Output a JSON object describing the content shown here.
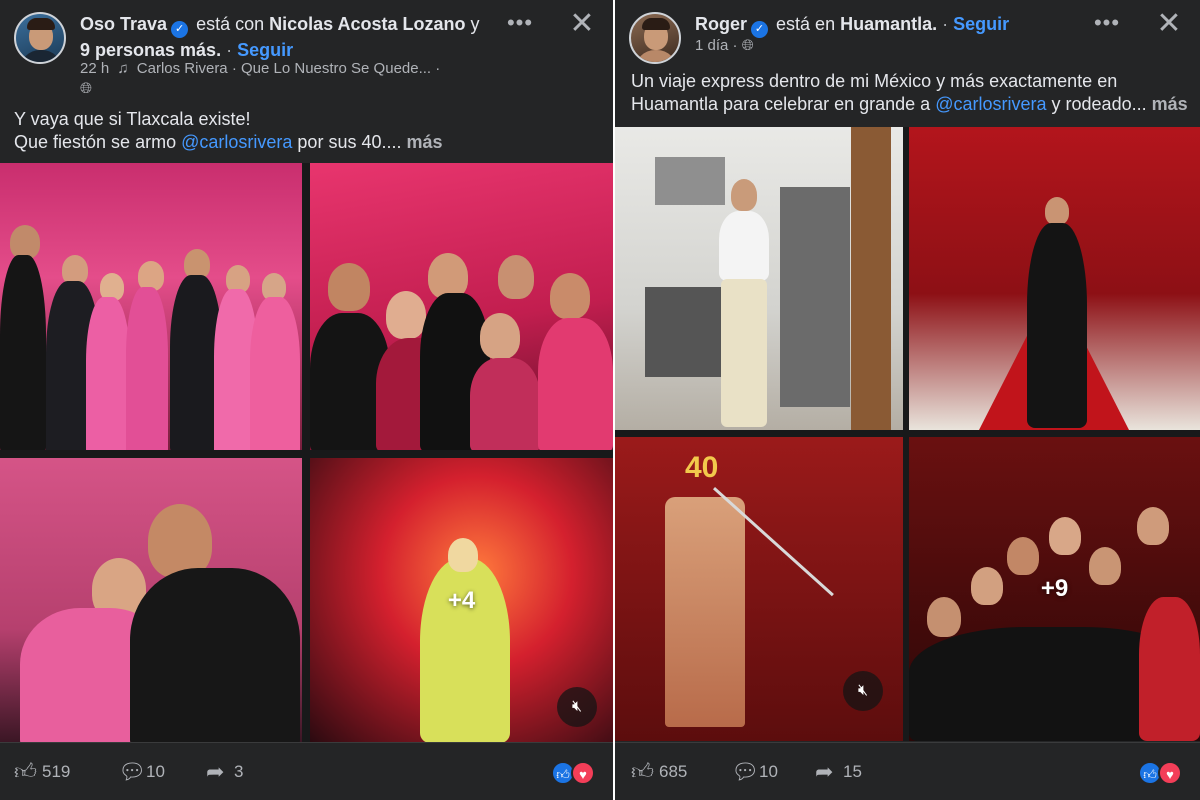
{
  "left_post": {
    "author": "Oso Trava",
    "with_text": "está con",
    "tagged": "Nicolas Acosta Lozano",
    "and_text": "y",
    "others": "9 personas más.",
    "follow": "Seguir",
    "time": "22 h",
    "music": "Carlos Rivera · Que Lo Nuestro Se Quede...",
    "caption_line1": "Y vaya que si Tlaxcala existe!",
    "caption_line2_pre": "Que fiestón se armo",
    "mention": "@carlosrivera",
    "caption_line2_post": "por sus 40....",
    "more": "más",
    "extra_photos": "+4",
    "likes": "519",
    "comments": "10",
    "shares": "3"
  },
  "right_post": {
    "author": "Roger",
    "at_text": "está en",
    "place": "Huamantla.",
    "follow": "Seguir",
    "time": "1 día",
    "caption_line1": "Un viaje express dentro de mi México y más exactamente en",
    "caption_line2_pre": "Huamantla para celebrar en grande a",
    "mention": "@carlosrivera",
    "caption_line2_post": "y rodeado...",
    "more": "más",
    "cake_number": "40",
    "extra_photos": "+9",
    "likes": "685",
    "comments": "10",
    "shares": "15"
  },
  "icons": {
    "verified": "verified-badge-icon",
    "more": "more-options-icon",
    "close": "close-icon",
    "music": "music-note-icon",
    "globe": "globe-icon",
    "like": "thumbs-up-icon",
    "comment": "comment-bubble-icon",
    "share": "share-arrow-icon",
    "mute": "muted-speaker-icon"
  },
  "colors": {
    "panel": "#242526",
    "text": "#e4e6eb",
    "secondary": "#b0b3b8",
    "link": "#4599ff",
    "verified": "#1b74e4",
    "love": "#f33e58"
  }
}
